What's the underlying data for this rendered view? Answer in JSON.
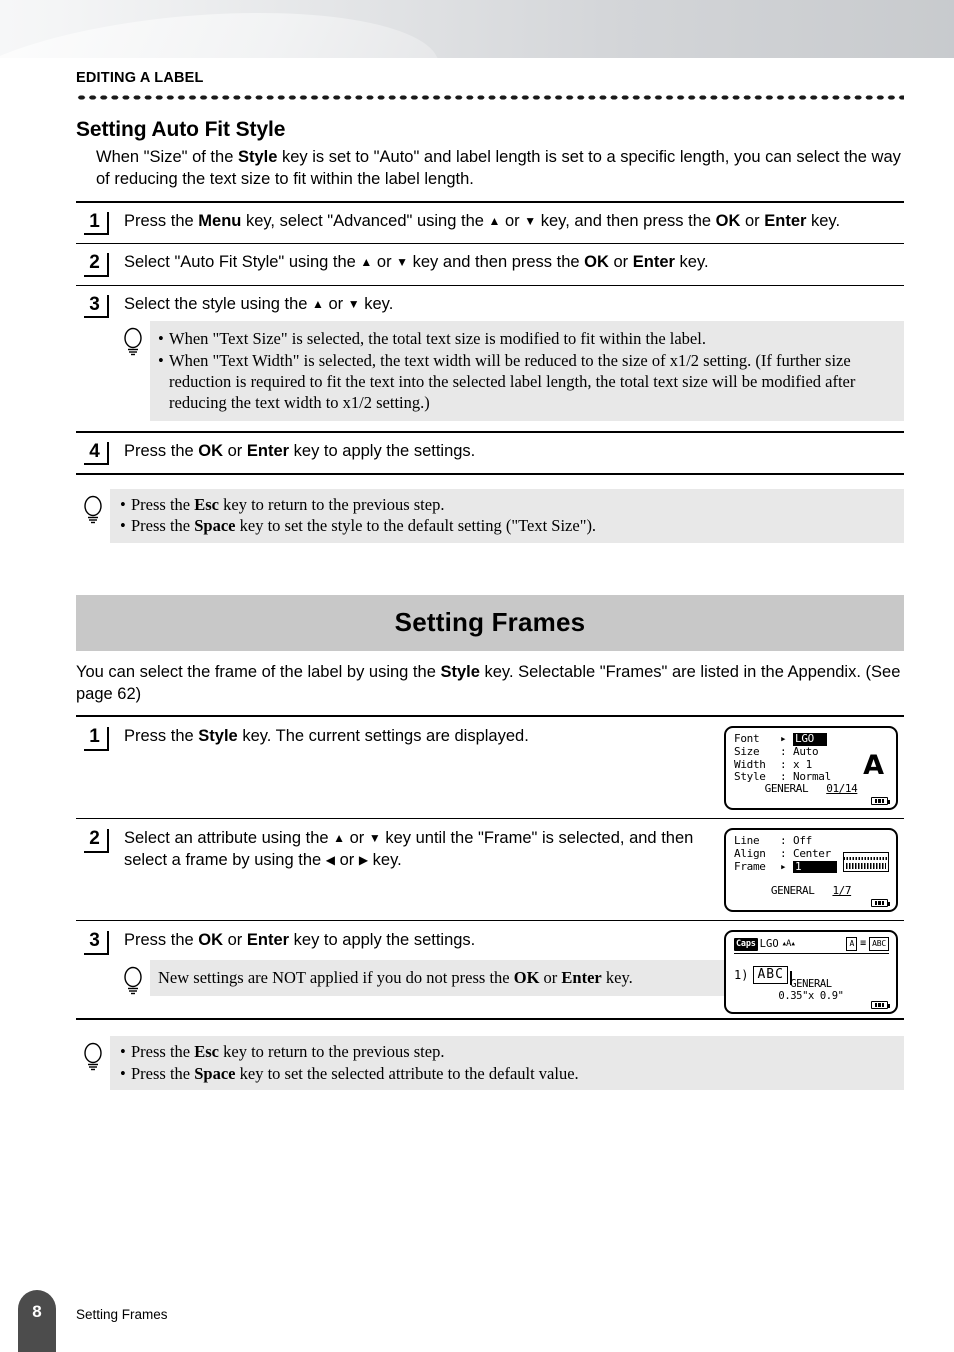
{
  "header": {
    "chapter": "EDITING A LABEL"
  },
  "auto_fit": {
    "title": "Setting Auto Fit Style",
    "intro": "When \"Size\" of the Style key is set to \"Auto\" and label length is set to a specific length, you can select the way of reducing the text size to fit within the label length.",
    "steps": [
      {
        "num": "1",
        "text": "Press the Menu key, select \"Advanced\" using the ▲ or ▼ key, and then press the OK or Enter key."
      },
      {
        "num": "2",
        "text": "Select \"Auto Fit Style\" using the ▲ or ▼ key and then press the OK or Enter key."
      },
      {
        "num": "3",
        "text": "Select the style using the ▲ or ▼ key."
      },
      {
        "num": "4",
        "text": "Press the OK or Enter key to apply the settings."
      }
    ],
    "tip_after_step3": [
      "When \"Text Size\" is selected, the total text size is modified to fit within the label.",
      "When \"Text Width\" is selected, the text width will be reduced to the size of x1/2 setting. (If further size reduction is required to fit the text into the selected label length, the total text size will be modified after reducing the text width to x1/2 setting.)"
    ],
    "tip_end": [
      "Press the Esc key to return to the previous step.",
      "Press the Space key to set the style to the default setting (\"Text Size\")."
    ]
  },
  "frames": {
    "banner": "Setting Frames",
    "intro": "You can select the frame of the label by using the Style key. Selectable \"Frames\" are listed in the Appendix. (See page 62)",
    "steps": [
      {
        "num": "1",
        "text": "Press the Style key. The current settings are displayed."
      },
      {
        "num": "2",
        "text": "Select an attribute using the ▲ or ▼ key until the \"Frame\" is selected, and then select a frame by using the ◀ or ▶ key."
      },
      {
        "num": "3",
        "text": "Press the OK or Enter key to apply the settings."
      }
    ],
    "step3_note": "New settings are NOT applied if you do not press the OK or Enter key.",
    "tip_end": [
      "Press the Esc key to return to the previous step.",
      "Press the Space key to set the selected attribute to the default value."
    ]
  },
  "lcd1": {
    "rows": [
      {
        "key": "Font",
        "sep": ":",
        "value": "LGO",
        "selected": true,
        "caret": "▸"
      },
      {
        "key": "Size",
        "sep": ":",
        "value": "Auto",
        "selected": false,
        "caret": ""
      },
      {
        "key": "Width",
        "sep": ":",
        "value": "x 1",
        "selected": false,
        "caret": ""
      },
      {
        "key": "Style",
        "sep": ":",
        "value": "Normal",
        "selected": false,
        "caret": ""
      }
    ],
    "preview_char": "A",
    "mode": "GENERAL",
    "counter": "01/14"
  },
  "lcd2": {
    "rows": [
      {
        "key": "Line",
        "sep": ":",
        "value": "Off",
        "selected": false,
        "caret": ""
      },
      {
        "key": "Align",
        "sep": ":",
        "value": "Center",
        "selected": false,
        "caret": ""
      },
      {
        "key": "Frame",
        "sep": ":",
        "value": "1",
        "selected": true,
        "caret": "▸"
      }
    ],
    "mode": "GENERAL",
    "counter": "1/7"
  },
  "lcd3": {
    "status_caps": "Caps",
    "status_font": "LGO",
    "status_size_icon": "▴A▴",
    "status_icons": [
      "A",
      "≡",
      "ABC"
    ],
    "line_marker": "1)",
    "text": "ABC",
    "mode": "GENERAL",
    "dimensions": "0.35\"x 0.9\""
  },
  "footer": {
    "page": "8",
    "label": "Setting Frames"
  }
}
